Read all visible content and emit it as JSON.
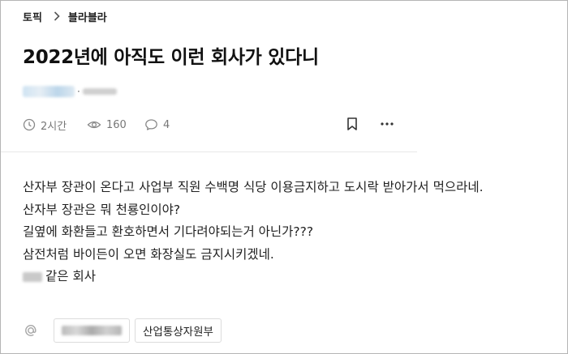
{
  "breadcrumb": {
    "topic": "토픽",
    "board": "블라블라"
  },
  "post": {
    "title": "2022년에 아직도 이런 회사가 있다니",
    "author": {
      "separator": "·"
    },
    "meta": {
      "time": "2시간",
      "views": "160",
      "comments": "4"
    },
    "body": [
      "산자부 장관이 온다고 사업부 직원 수백명 식당 이용금지하고 도시락 받아가서 먹으라네.",
      "산자부 장관은 뭐 천룡인이야?",
      "길옆에 화환들고 환호하면서 기다려야되는거 아닌가???",
      "삼전처럼 바이든이 오면 화장실도 금지시키겠네."
    ],
    "last_line_suffix": "같은 회사"
  },
  "tags": {
    "at_symbol": "@",
    "items": [
      "산업통상자원부"
    ]
  },
  "icons": {
    "breadcrumb_separator": "chevron-right-icon",
    "time": "clock-icon",
    "views": "eye-icon",
    "comments": "comment-icon",
    "bookmark": "bookmark-icon",
    "more": "more-icon"
  }
}
